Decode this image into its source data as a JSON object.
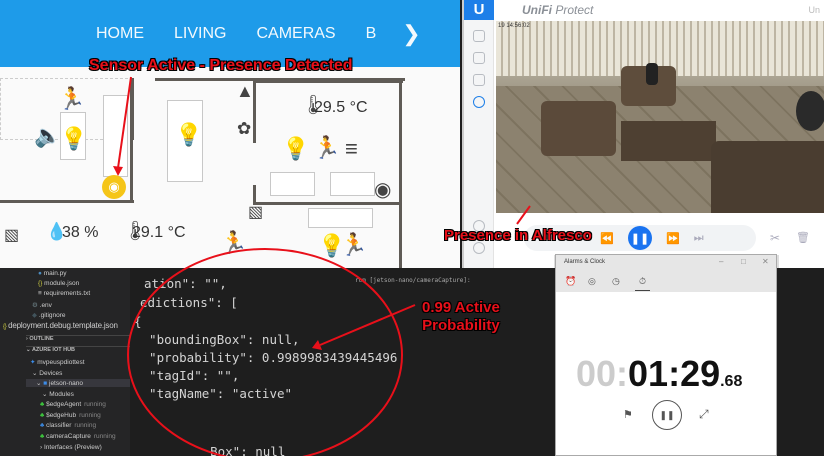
{
  "home": {
    "nav": [
      "HOME",
      "LIVING",
      "CAMERAS",
      "B"
    ],
    "nav_next_icon": "chevron-right-icon",
    "humidity": "38 %",
    "temp_living": "29.1 °C",
    "temp_bedroom": "29.5 °C",
    "accent": "#1e9be9",
    "active_color": "#f5c518"
  },
  "unifi": {
    "logo": "U",
    "title_brand": "UniFi",
    "title_product": "Protect",
    "header_right": "Un",
    "timestamp": "19 14:56:02"
  },
  "vscode": {
    "tree": [
      {
        "label": "main.py",
        "icon": "python-icon"
      },
      {
        "label": "module.json",
        "icon": "json-icon"
      },
      {
        "label": "requirements.txt",
        "icon": "file-icon"
      },
      {
        "label": ".env",
        "icon": "gear-icon"
      },
      {
        "label": ".gitignore",
        "icon": "git-icon"
      },
      {
        "label": "deployment.debug.template.json",
        "icon": "json-icon"
      }
    ],
    "outline": "OUTLINE",
    "iot_hub": "AZURE IOT HUB",
    "hub_name": "mvpeuspdiottest",
    "devices": "Devices",
    "device": "jetson-nano",
    "modules_label": "Modules",
    "modules": [
      {
        "name": "$edgeAgent",
        "status": "running"
      },
      {
        "name": "$edgeHub",
        "status": "running"
      },
      {
        "name": "classifier",
        "status": "running"
      },
      {
        "name": "cameraCapture",
        "status": "running"
      }
    ],
    "interfaces": "Interfaces (Preview)",
    "output_header": "rom [jetson-nano/cameraCapture]:",
    "code": [
      "ation\": \"\",",
      "edictions\": [",
      "{",
      "  \"boundingBox\": null,",
      "  \"probability\": 0.9989983439445496",
      "  \"tagId\": \"\",",
      "  \"tagName\": \"active\"",
      "    Box\": null"
    ]
  },
  "clock": {
    "title": "Alarms & Clock",
    "tabs": [
      "alarm-icon",
      "world-clock-icon",
      "timer-icon",
      "stopwatch-icon"
    ],
    "hours": "00:",
    "main": "01:29",
    "fraction": ".68"
  },
  "annotations": {
    "sensor": "Sensor Active - Presence Detected",
    "presence": "Presence in Alfresco",
    "probability_line1": "0.99 Active",
    "probability_line2": "Probability",
    "color": "#e8101a"
  }
}
